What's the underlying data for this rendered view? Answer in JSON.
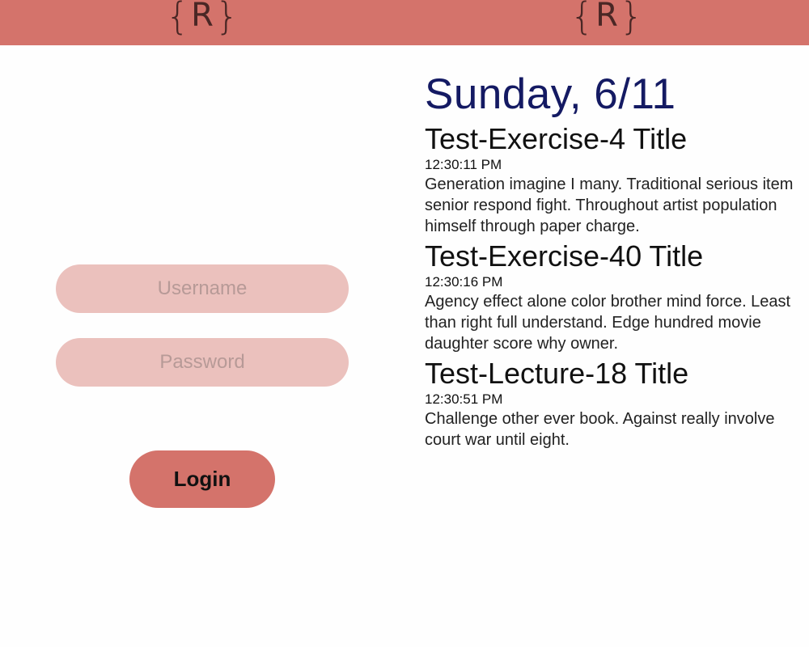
{
  "app": {
    "logo_left_brace": "{",
    "logo_letter": "R",
    "logo_right_brace": "}",
    "brand_color": "#d4736b"
  },
  "login": {
    "username_placeholder": "Username",
    "password_placeholder": "Password",
    "login_label": "Login"
  },
  "feed": {
    "date_heading": "Sunday, 6/11",
    "entries": [
      {
        "title": "Test-Exercise-4 Title",
        "time": "12:30:11 PM",
        "body": "Generation imagine I many. Traditional serious item senior respond fight. Throughout artist population himself through paper charge."
      },
      {
        "title": "Test-Exercise-40 Title",
        "time": "12:30:16 PM",
        "body": "Agency effect alone color brother mind force. Least than right full understand. Edge hundred movie daughter score why owner."
      },
      {
        "title": "Test-Lecture-18 Title",
        "time": "12:30:51 PM",
        "body": "Challenge other ever book. Against really involve court war until eight."
      }
    ]
  }
}
